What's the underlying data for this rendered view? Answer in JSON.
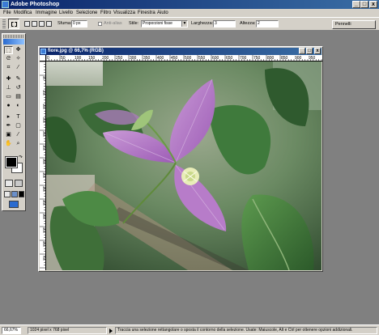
{
  "window": {
    "title": "Adobe Photoshop",
    "controls": {
      "minimize": "_",
      "maximize": "□",
      "close": "x"
    }
  },
  "menu": [
    "File",
    "Modifica",
    "Immagine",
    "Livello",
    "Selezione",
    "Filtro",
    "Visualizza",
    "Finestra",
    "Aiuto"
  ],
  "options_bar": {
    "feather_label": "Sfuma:",
    "feather_value": "0 px",
    "antialias_label": "Anti-alias",
    "style_label": "Stile:",
    "style_value": "Proporzioni fisse",
    "width_label": "Larghezza:",
    "width_value": "3",
    "height_label": "Altezza:",
    "height_value": "2",
    "palette_tab": "Pennelli"
  },
  "document": {
    "title": "fiore.jpg @ 66,7% (RGB)",
    "ruler_labels": [
      "0",
      "50",
      "100",
      "150",
      "200",
      "250",
      "300",
      "350",
      "400",
      "450",
      "500",
      "550",
      "600",
      "650",
      "700",
      "750",
      "800",
      "850",
      "900",
      "950"
    ],
    "vruler_labels": [
      "50",
      "100",
      "150",
      "200",
      "250",
      "300",
      "350",
      "400",
      "450",
      "500",
      "550",
      "600",
      "650",
      "700"
    ]
  },
  "status": {
    "zoom": "66,67%",
    "doc_size": "1024 pixel x 768 pixel",
    "hint": "Traccia una selezione rettangolare o sposta il contorno della selezione. Usate: Maiuscole, Alt e Ctrl per ottenere opzioni addizionali."
  },
  "colors": {
    "titlebar_start": "#0a246a",
    "titlebar_end": "#3a6ea5",
    "chrome": "#d4d0c8",
    "workspace": "#808080"
  }
}
